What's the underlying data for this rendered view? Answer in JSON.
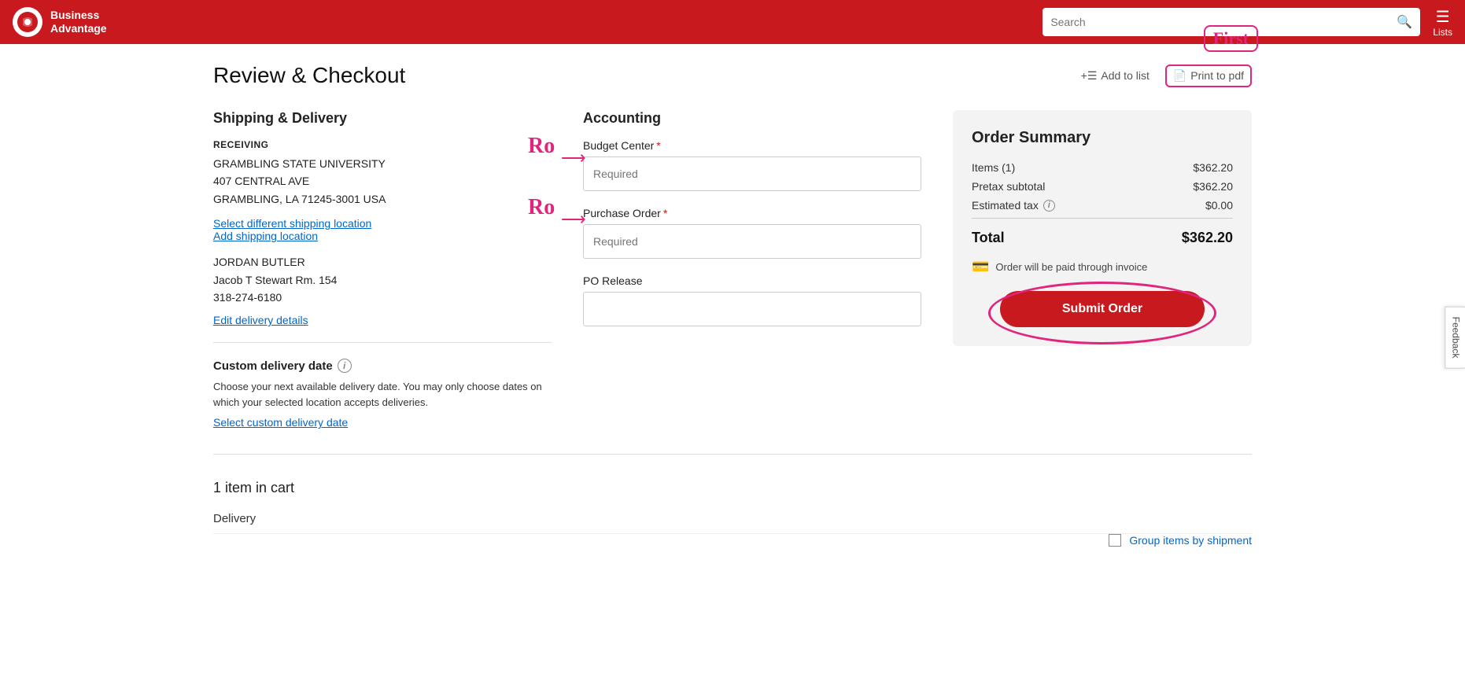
{
  "header": {
    "logo_line1": "Business",
    "logo_line2": "Advantage",
    "search_placeholder": "Search",
    "lists_label": "Lists"
  },
  "page": {
    "title": "Review & Checkout",
    "add_to_list_label": "Add to list",
    "print_to_pdf_label": "Print to pdf",
    "first_annotation": "First"
  },
  "shipping": {
    "section_title": "Shipping & Delivery",
    "receiving_label": "RECEIVING",
    "university": "GRAMBLING STATE UNIVERSITY",
    "address1": "407 CENTRAL AVE",
    "city_state": "GRAMBLING, LA 71245-3001 USA",
    "select_different_link": "Select different shipping location",
    "add_shipping_link": "Add shipping location",
    "contact_name": "JORDAN BUTLER",
    "room": "Jacob T Stewart Rm. 154",
    "phone": "318-274-6180",
    "edit_delivery_link": "Edit delivery details",
    "custom_delivery_title": "Custom delivery date",
    "delivery_note_1": "Choose your next available delivery date.",
    "delivery_note_2": " You may only choose dates on which your selected location accepts deliveries.",
    "select_custom_link": "Select custom delivery date"
  },
  "accounting": {
    "section_title": "Accounting",
    "budget_center_label": "Budget Center",
    "budget_center_placeholder": "Required",
    "purchase_order_label": "Purchase Order",
    "purchase_order_placeholder": "Required",
    "po_release_label": "PO Release",
    "po_release_value": ""
  },
  "order_summary": {
    "title": "Order Summary",
    "items_label": "Items (1)",
    "items_value": "$362.20",
    "pretax_label": "Pretax subtotal",
    "pretax_value": "$362.20",
    "tax_label": "Estimated tax",
    "tax_value": "$0.00",
    "total_label": "Total",
    "total_value": "$362.20",
    "invoice_note": "Order will be paid through invoice",
    "submit_label": "Submit Order"
  },
  "cart": {
    "items_count": "1 item in cart",
    "delivery_label": "Delivery",
    "group_items_label": "Group items by",
    "group_items_highlight": "shipment"
  },
  "feedback": {
    "label": "Feedback"
  }
}
